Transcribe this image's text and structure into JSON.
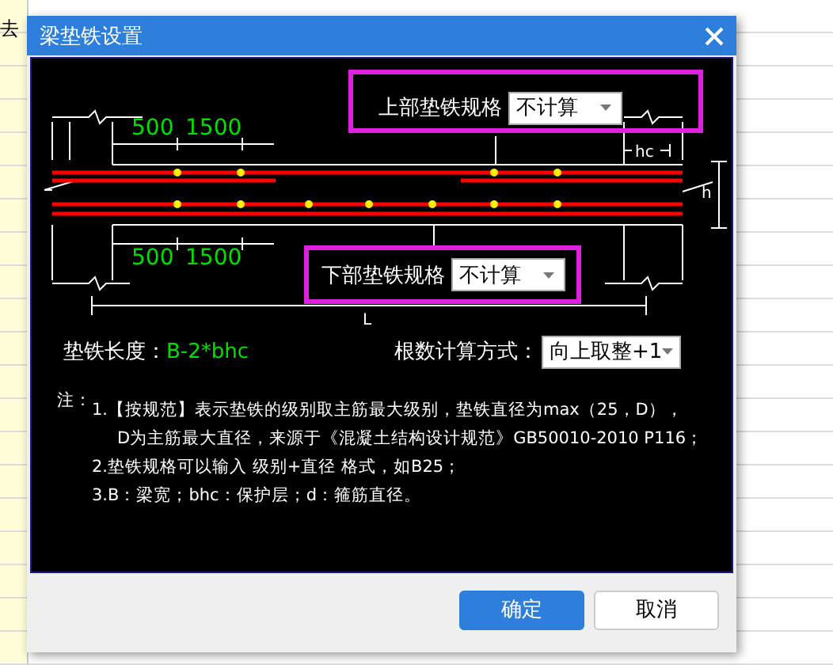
{
  "background": {
    "text": "去"
  },
  "dialog": {
    "title": "梁垫铁设置"
  },
  "diagram": {
    "top_dims": [
      "500",
      "1500"
    ],
    "bottom_dims": [
      "500",
      "1500"
    ],
    "hc_label": "hc",
    "h_label": "h",
    "length_label": "L"
  },
  "upper_spec": {
    "label": "上部垫铁规格",
    "value": "不计算"
  },
  "lower_spec": {
    "label": "下部垫铁规格",
    "value": "不计算"
  },
  "pad_length": {
    "label": "垫铁长度：",
    "value": "B-2*bhc"
  },
  "count_method": {
    "label": "根数计算方式：",
    "value": "向上取整+1"
  },
  "notes": {
    "heading": "注：",
    "items": [
      {
        "text": "1.【按规范】表示垫铁的级别取主筋最大级别，垫铁直径为max（25，D），",
        "continuation": "D为主筋最大直径，来源于《混凝土结构设计规范》GB50010-2010 P116；"
      },
      {
        "text": "2.垫铁规格可以输入 级别+直径 格式，如B25；"
      },
      {
        "text": "3.B：梁宽；bhc：保护层；d：箍筋直径。"
      }
    ]
  },
  "buttons": [
    {
      "label": "确定",
      "primary": true
    },
    {
      "label": "取消",
      "primary": false
    }
  ]
}
